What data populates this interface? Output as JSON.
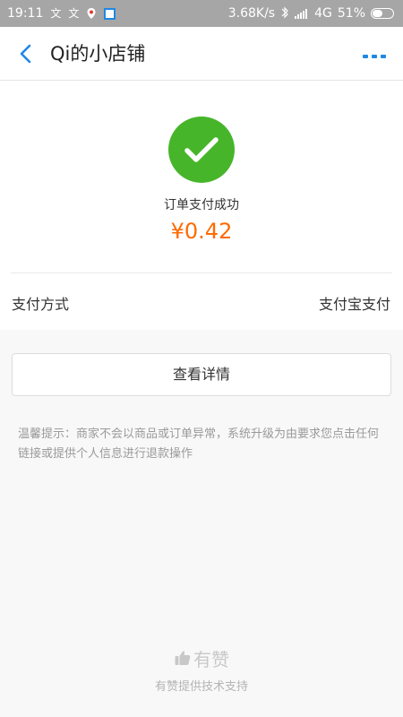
{
  "status_bar": {
    "time": "19:11",
    "left_glyphs": [
      "文",
      "文"
    ],
    "net_speed": "3.68K/s",
    "network_type": "4G",
    "battery_percent": "51%",
    "battery_level": 0.51
  },
  "header": {
    "title": "Qi的小店铺",
    "back_icon": "chevron-left-icon",
    "more_icon": "more-dots-icon",
    "accent_color": "#1f88e5"
  },
  "success": {
    "message": "订单支付成功",
    "amount": "¥0.42",
    "icon": "check-circle-icon",
    "icon_color": "#47b52a",
    "amount_color": "#ff6a00"
  },
  "payment": {
    "label": "支付方式",
    "value": "支付宝支付"
  },
  "actions": {
    "details_label": "查看详情"
  },
  "tip": {
    "text": "温馨提示：商家不会以商品或订单异常，系统升级为由要求您点击任何链接或提供个人信息进行退款操作"
  },
  "footer": {
    "brand": "有赞",
    "subtitle": "有赞提供技术支持",
    "icon": "thumbs-up-icon"
  }
}
